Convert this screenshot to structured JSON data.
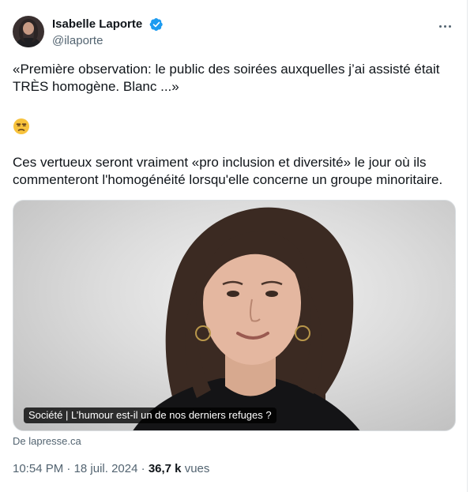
{
  "author": {
    "display_name": "Isabelle Laporte",
    "handle": "@ilaporte",
    "verified": true,
    "avatar_icon": "profile-photo"
  },
  "tweet": {
    "paragraph_1": "«Première observation: le public des soirées auxquelles j’ai assisté était TRÈS homogène. Blanc ...»",
    "emoji": "unamused-face-emoji",
    "paragraph_2": "Ces vertueux seront vraiment «pro inclusion et diversité» le jour où ils commenteront l'homogénéité lorsqu'elle concerne un groupe minoritaire."
  },
  "link_card": {
    "caption": "Société | L’humour est-il un de nos derniers refuges ?",
    "source": "De lapresse.ca"
  },
  "meta": {
    "time": "10:54 PM",
    "separator": "·",
    "date": "18 juil. 2024",
    "views_count": "36,7 k",
    "views_label": "vues"
  },
  "colors": {
    "text": "#0f1419",
    "secondary": "#536471",
    "verified_blue": "#1d9bf0"
  }
}
